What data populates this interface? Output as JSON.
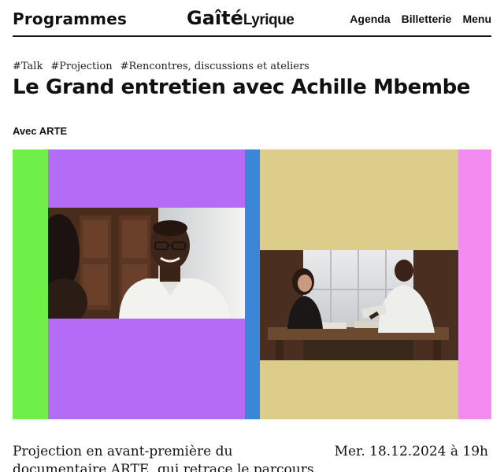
{
  "header": {
    "programmes": "Programmes",
    "logo_main": "Gaîté",
    "logo_sub": "Lyrique",
    "nav": [
      "Agenda",
      "Billetterie",
      "Menu"
    ]
  },
  "event": {
    "tags": [
      "#Talk",
      "#Projection",
      "#Rencontres, discussions et ateliers"
    ],
    "title": "Le Grand entretien avec Achille Mbembe",
    "subtitle": "Avec ARTE",
    "description": "Projection en avant-première du documentaire ARTE, qui retrace le parcours",
    "date": "Mer. 18.12.2024 à 19h"
  },
  "colors": {
    "green": "#6ff048",
    "purple": "#b46cf7",
    "blue": "#3b86d6",
    "tan": "#ddcd8b",
    "pink": "#f38bf0"
  }
}
